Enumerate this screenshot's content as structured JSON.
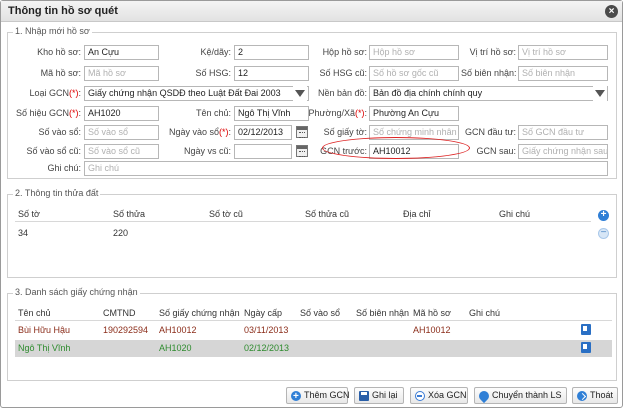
{
  "title": "Thông tin hồ sơ quét",
  "close_label": "×",
  "section1": {
    "legend": "1. Nhập mới hồ sơ",
    "fields": {
      "kho_ho_so": {
        "label": "Kho hồ sơ:",
        "value": "An Cựu"
      },
      "ke_day": {
        "label": "Kệ/dãy:",
        "value": "2"
      },
      "hop_ho_so": {
        "label": "Hộp hồ sơ:",
        "placeholder": "Hộp hồ sơ"
      },
      "vi_tri_ho_so": {
        "label": "Vị trí hồ sơ:",
        "placeholder": "Vị trí hồ sơ"
      },
      "ma_ho_so": {
        "label": "Mã hồ sơ:",
        "placeholder": "Mã hồ sơ"
      },
      "so_hsg": {
        "label": "Số HSG:",
        "value": "12"
      },
      "so_hsg_cu": {
        "label": "Số HSG cũ:",
        "placeholder": "Số hồ sơ gốc cũ"
      },
      "so_bien_nhan": {
        "label": "Số biên nhận:",
        "placeholder": "Số biên nhận"
      },
      "loai_gcn": {
        "label": "Loại GCN",
        "req": "(*)",
        "colon": ":",
        "value": "Giấy chứng nhận QSDĐ theo Luật Đất Đai 2003"
      },
      "nen_ban_do": {
        "label": "Nền bản đồ:",
        "value": "Bản đồ địa chính chính quy"
      },
      "so_hieu_gcn": {
        "label": "Số hiệu GCN",
        "req": "(*)",
        "colon": ":",
        "value": "AH1020"
      },
      "ten_chu": {
        "label": "Tên chủ:",
        "value": "Ngô Thị Vĩnh"
      },
      "phuong_xa": {
        "label": "Phường/Xã",
        "req": "(*)",
        "colon": ":",
        "value": "Phường An Cựu"
      },
      "so_vao_so": {
        "label": "Số vào sổ:",
        "placeholder": "Số vào sổ"
      },
      "ngay_vao_so": {
        "label": "Ngày vào sổ",
        "req": "(*)",
        "colon": ":",
        "value": "02/12/2013"
      },
      "so_giay_to": {
        "label": "Số giấy tờ:",
        "placeholder": "Số chứng minh nhân d"
      },
      "gcn_dau_tu": {
        "label": "GCN đầu tư:",
        "placeholder": "Số GCN đầu tư"
      },
      "so_vao_so_cu": {
        "label": "Số vào sổ cũ:",
        "placeholder": "Số vào sổ cũ"
      },
      "ngay_vs_cu": {
        "label": "Ngày vs cũ:",
        "value": ""
      },
      "gcn_truoc": {
        "label": "GCN trước:",
        "value": "AH10012"
      },
      "gcn_sau": {
        "label": "GCN sau:",
        "placeholder": "Giấy chứng nhận sau"
      },
      "ghi_chu": {
        "label": "Ghi chú:",
        "placeholder": "Ghi chú"
      }
    }
  },
  "section2": {
    "legend": "2. Thông tin thửa đất",
    "columns": [
      "Số tờ",
      "Số thửa",
      "Số tờ cũ",
      "Số thửa cũ",
      "Địa chỉ",
      "Ghi chú"
    ],
    "rows": [
      {
        "so_to": "34",
        "so_thua": "220",
        "so_to_cu": "",
        "so_thua_cu": "",
        "dia_chi": "",
        "ghi_chu": ""
      }
    ]
  },
  "section3": {
    "legend": "3. Danh sách giấy chứng nhận",
    "columns": [
      "Tên chủ",
      "CMTND",
      "Số giấy chứng nhận",
      "Ngày cấp",
      "Số vào sổ",
      "Số biên nhận",
      "Mã hồ sơ",
      "Ghi chú"
    ],
    "rows": [
      {
        "ten_chu": "Bùi Hữu Hậu",
        "cmtnd": "190292594",
        "so_gcn": "AH10012",
        "ngay_cap": "03/11/2013",
        "so_vao_so": "",
        "so_bien_nhan": "",
        "ma_ho_so": "AH10012",
        "ghi_chu": ""
      },
      {
        "ten_chu": "Ngô Thị Vĩnh",
        "cmtnd": "",
        "so_gcn": "AH1020",
        "ngay_cap": "02/12/2013",
        "so_vao_so": "",
        "so_bien_nhan": "",
        "ma_ho_so": "",
        "ghi_chu": ""
      }
    ]
  },
  "buttons": {
    "them_gcn": "Thêm GCN",
    "ghi_lai": "Ghi lại",
    "xoa_gcn": "Xóa GCN",
    "chuyen_ls": "Chuyển thành LS",
    "thoat": "Thoát"
  },
  "colors": {
    "row1_text": "#8b2d1a",
    "row2_text": "#2e8b2e",
    "row2_bg": "#d6d6d6",
    "highlight": "#d22222"
  }
}
